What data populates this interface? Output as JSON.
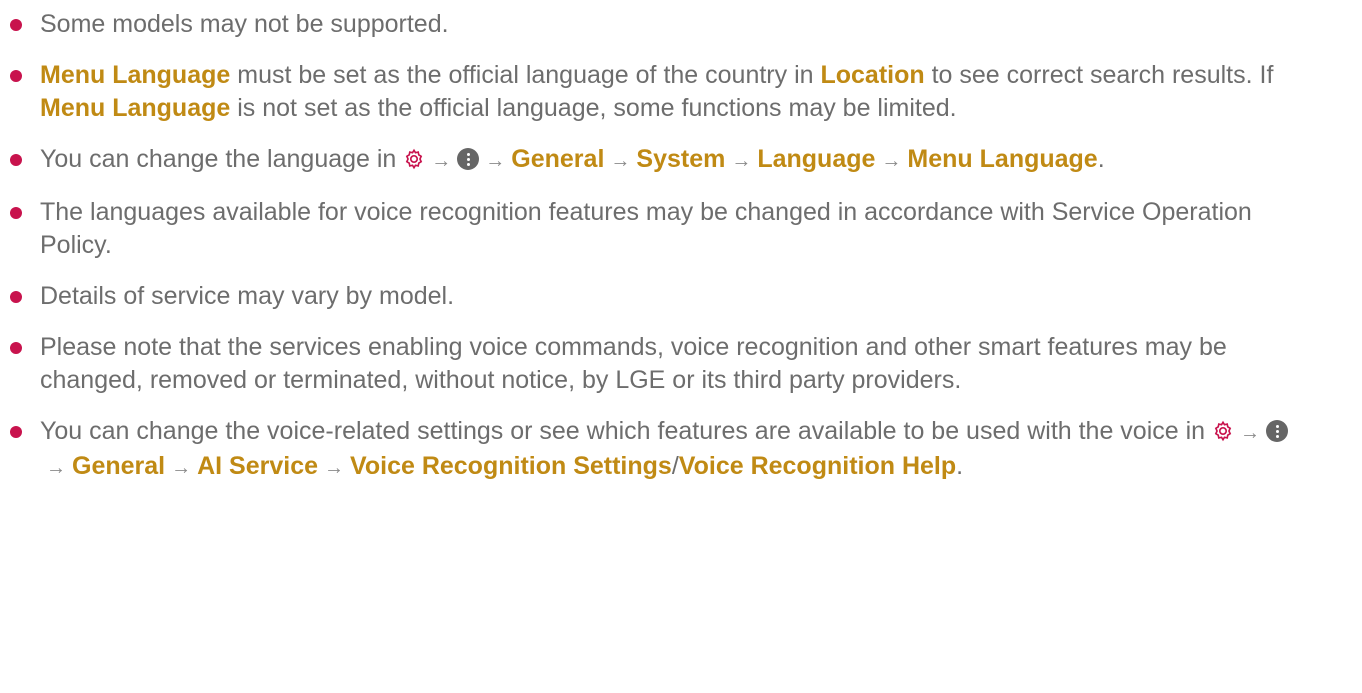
{
  "notes": [
    {
      "text": "Some models may not be supported."
    },
    {
      "highlight_1": "Menu Language",
      "text_1": " must be set as the official language of the country in ",
      "highlight_2": "Location",
      "text_2": " to see correct search results. If ",
      "highlight_3": "Menu Language",
      "text_3": " is not set as the official language, some functions may be limited."
    },
    {
      "text_1": "You can change the language in ",
      "path": [
        "General",
        "System",
        "Language",
        "Menu Language"
      ],
      "end": "."
    },
    {
      "text": "The languages available for voice recognition features may be changed in accordance with Service Operation Policy."
    },
    {
      "text": "Details of service may vary by model."
    },
    {
      "text": "Please note that the services enabling voice commands, voice recognition and other smart features may be changed, removed or terminated, without notice, by LGE or its third party providers."
    },
    {
      "text_1": "You can change the voice-related settings or see which features are available to be used with the voice in ",
      "path": [
        "General",
        "AI Service",
        "Voice Recognition Settings"
      ],
      "separator": "/",
      "path_last": "Voice Recognition Help",
      "end": "."
    }
  ],
  "icons": {
    "settings": "gear-icon",
    "more": "more-options-icon",
    "arrow": "→"
  },
  "colors": {
    "bullet": "#c8134d",
    "highlight": "#c08a14",
    "text": "#6d6d6d"
  }
}
